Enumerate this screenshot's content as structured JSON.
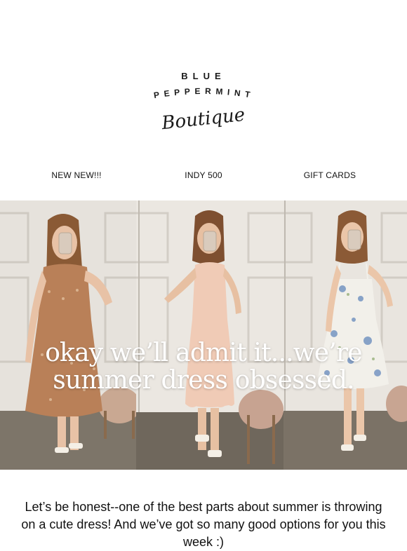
{
  "logo": {
    "line1": "BLUE",
    "line2": "PEPPERMINT",
    "line3": "Boutique"
  },
  "nav": {
    "items": [
      {
        "label": "NEW NEW!!!"
      },
      {
        "label": "INDY 500"
      },
      {
        "label": "GIFT CARDS"
      }
    ]
  },
  "hero": {
    "headline_line1": "okay we’ll admit it...we’re",
    "headline_line2": "summer dress obsessed."
  },
  "intro": {
    "text": "Let’s be honest--one of the best parts about summer is throwing on a cute dress! And we’ve got so many good options for you this week :)"
  },
  "colors": {
    "background": "#ffffff",
    "text": "#111111",
    "hero_text": "#ffffff"
  }
}
